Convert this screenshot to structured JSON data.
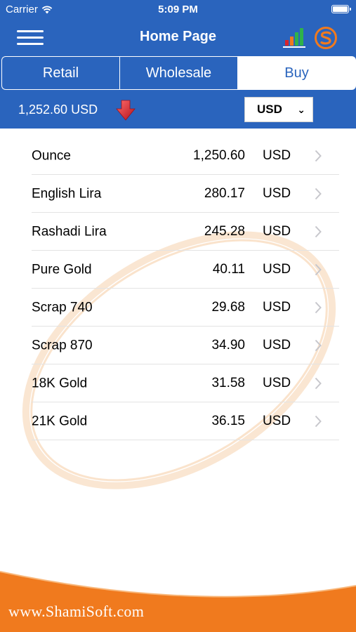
{
  "status_bar": {
    "carrier": "Carrier",
    "time": "5:09 PM"
  },
  "nav": {
    "title": "Home Page"
  },
  "tabs": [
    {
      "label": "Retail",
      "active": false
    },
    {
      "label": "Wholesale",
      "active": false
    },
    {
      "label": "Buy",
      "active": true
    }
  ],
  "price_bar": {
    "current_price": "1,252.60 USD",
    "trend": "down",
    "currency": "USD"
  },
  "rows": [
    {
      "name": "Ounce",
      "value": "1,250.60",
      "currency": "USD"
    },
    {
      "name": "English Lira",
      "value": "280.17",
      "currency": "USD"
    },
    {
      "name": "Rashadi Lira",
      "value": "245.28",
      "currency": "USD"
    },
    {
      "name": "Pure Gold",
      "value": "40.11",
      "currency": "USD"
    },
    {
      "name": "Scrap 740",
      "value": "29.68",
      "currency": "USD"
    },
    {
      "name": "Scrap 870",
      "value": "34.90",
      "currency": "USD"
    },
    {
      "name": "18K Gold",
      "value": "31.58",
      "currency": "USD"
    },
    {
      "name": "21K Gold",
      "value": "36.15",
      "currency": "USD"
    }
  ],
  "footer": {
    "website": "www.ShamiSoft.com"
  },
  "colors": {
    "header": "#2a64bd",
    "accent_orange": "#f07a1e",
    "down_arrow": "#d9252b"
  },
  "icons": [
    "wifi-icon",
    "battery-icon",
    "menu-icon",
    "chart-icon",
    "shamisoft-logo-icon",
    "down-arrow-icon",
    "chevron-right-icon"
  ]
}
